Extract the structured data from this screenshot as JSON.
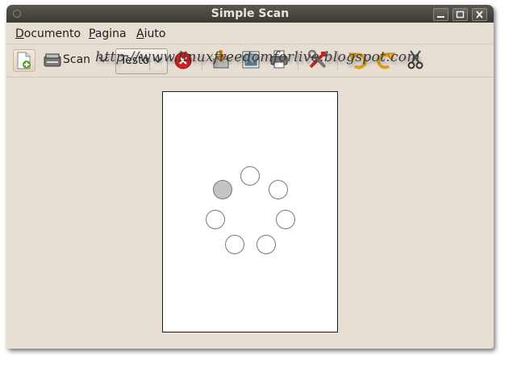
{
  "window": {
    "title": "Simple Scan"
  },
  "menubar": {
    "items": [
      {
        "accel": "D",
        "rest": "ocumento"
      },
      {
        "accel": "P",
        "rest": "agina"
      },
      {
        "accel": "A",
        "rest": "iuto"
      }
    ]
  },
  "toolbar": {
    "scan_label": "Scan",
    "mode_selected": "Testo"
  },
  "document": {
    "watermark": "http://www.linuxfreedomforlive.blogspot.com"
  },
  "colors": {
    "window_bg": "#e6ddd3",
    "titlebar": "#3b3935",
    "spinner_active": "#c4c4c4"
  },
  "icons": {
    "new": "new-document-icon",
    "scanner": "scanner-icon",
    "stop": "stop-icon",
    "save": "save-icon",
    "email": "email-icon",
    "print": "printer-icon",
    "preferences": "preferences-icon",
    "rotate_left": "rotate-left-icon",
    "rotate_right": "rotate-right-icon",
    "crop": "crop-scissors-icon"
  }
}
